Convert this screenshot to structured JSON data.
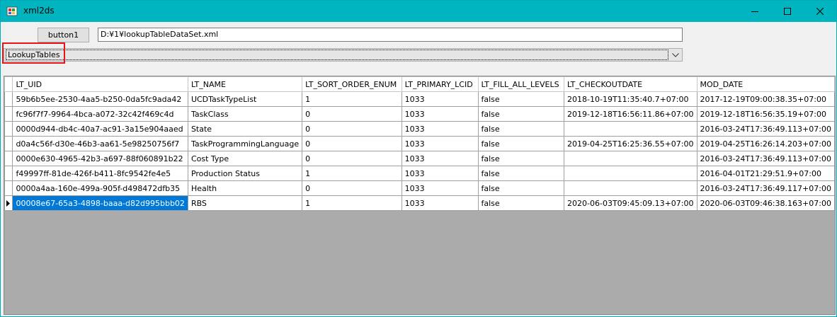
{
  "window": {
    "title": "xml2ds",
    "controls": {
      "minimize": "minimize-icon",
      "maximize": "maximize-icon",
      "close": "close-icon"
    }
  },
  "toolbar": {
    "button1_label": "button1",
    "path_value": "D:¥1¥lookupTableDataSet.xml"
  },
  "combo": {
    "selected": "LookupTables"
  },
  "grid": {
    "columns": [
      "LT_UID",
      "LT_NAME",
      "LT_SORT_ORDER_ENUM",
      "LT_PRIMARY_LCID",
      "LT_FILL_ALL_LEVELS",
      "LT_CHECKOUTDATE",
      "MOD_DATE"
    ],
    "rows": [
      [
        "59b6b5ee-2530-4aa5-b250-0da5fc9ada42",
        "UCDTaskTypeList",
        "1",
        "1033",
        "false",
        "2018-10-19T11:35:40.7+07:00",
        "2017-12-19T09:00:38.35+07:00"
      ],
      [
        "fc96f7f7-9964-4bca-a072-32c42f469c4d",
        "TaskClass",
        "0",
        "1033",
        "false",
        "2019-12-18T16:56:11.86+07:00",
        "2019-12-18T16:56:35.19+07:00"
      ],
      [
        "0000d944-db4c-40a7-ac91-3a15e904aaed",
        "State",
        "0",
        "1033",
        "false",
        "",
        "2016-03-24T17:36:49.113+07:00"
      ],
      [
        "d0a4c56f-d30e-46b3-aa61-5e98250756f7",
        "TaskProgrammingLanguage",
        "0",
        "1033",
        "false",
        "2019-04-25T16:25:36.55+07:00",
        "2019-04-25T16:26:14.203+07:00"
      ],
      [
        "0000e630-4965-42b3-a697-88f060891b22",
        "Cost Type",
        "0",
        "1033",
        "false",
        "",
        "2016-03-24T17:36:49.113+07:00"
      ],
      [
        "f49997ff-81de-426f-b411-8fc9542fe4e5",
        "Production Status",
        "1",
        "1033",
        "false",
        "",
        "2016-04-01T21:29:51.9+07:00"
      ],
      [
        "0000a4aa-160e-499a-905f-d498472dfb35",
        "Health",
        "0",
        "1033",
        "false",
        "",
        "2016-03-24T17:36:49.117+07:00"
      ],
      [
        "00008e67-65a3-4898-baaa-d82d995bbb02",
        "RBS",
        "1",
        "1033",
        "false",
        "2020-06-03T09:45:09.13+07:00",
        "2020-06-03T09:46:38.163+07:00"
      ]
    ],
    "selected_row": 7
  },
  "colors": {
    "titlebar": "#00b4c0",
    "selection": "#0078d7",
    "highlight": "#e8141a",
    "grid_background": "#ababab"
  }
}
